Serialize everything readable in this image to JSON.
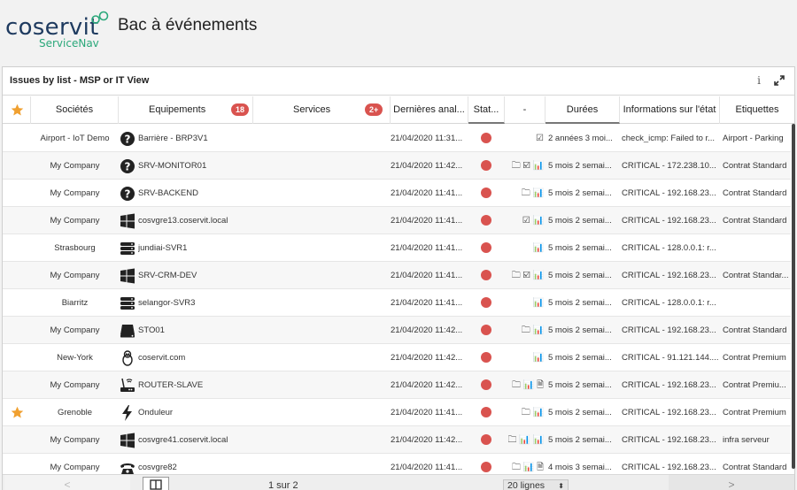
{
  "brand": {
    "name": "coservit",
    "sub": "ServiceNav",
    "accent": "#2aa87a",
    "primary": "#1e3a5f"
  },
  "page_title": "Bac à événements",
  "panel": {
    "title": "Issues by list - MSP or IT View",
    "info_icon": "info-icon",
    "expand_icon": "expand-icon"
  },
  "columns": {
    "companies": "Sociétés",
    "equipments": "Equipements",
    "equipments_badge": "18",
    "services": "Services",
    "services_badge": "2+",
    "last_analysis": "Dernières anal...",
    "status": "Stat...",
    "actions": "-",
    "durations": "Durées",
    "info": "Informations sur l'état",
    "tags": "Etiquettes"
  },
  "rows": [
    {
      "star": false,
      "company": "Airport - IoT Demo",
      "icon": "question",
      "equipment": "Barrière - BRP3V1",
      "date": "21/04/2020 11:31...",
      "actions": "☑",
      "duration": "2 années 3 moi...",
      "info": "check_icmp: Failed to r...",
      "tags": "Airport - Parking"
    },
    {
      "star": false,
      "company": "My Company",
      "icon": "question",
      "equipment": "SRV-MONITOR01",
      "date": "21/04/2020 11:42...",
      "actions": "🗀 ☑ 📊",
      "duration": "5 mois 2 semai...",
      "info": "CRITICAL - 172.238.10...",
      "tags": "Contrat Standard"
    },
    {
      "star": false,
      "company": "My Company",
      "icon": "question",
      "equipment": "SRV-BACKEND",
      "date": "21/04/2020 11:41...",
      "actions": "🗀 📊",
      "duration": "5 mois 2 semai...",
      "info": "CRITICAL - 192.168.23...",
      "tags": "Contrat Standard"
    },
    {
      "star": false,
      "company": "My Company",
      "icon": "windows",
      "equipment": "cosvgre13.coservit.local",
      "date": "21/04/2020 11:41...",
      "actions": "☑ 📊",
      "duration": "5 mois 2 semai...",
      "info": "CRITICAL - 192.168.23...",
      "tags": "Contrat Standard"
    },
    {
      "star": false,
      "company": "Strasbourg",
      "icon": "server",
      "equipment": "jundiai-SVR1",
      "date": "21/04/2020 11:41...",
      "actions": "📊",
      "duration": "5 mois 2 semai...",
      "info": "CRITICAL - 128.0.0.1: r...",
      "tags": ""
    },
    {
      "star": false,
      "company": "My Company",
      "icon": "windows",
      "equipment": "SRV-CRM-DEV",
      "date": "21/04/2020 11:41...",
      "actions": "🗀 ☑ 📊",
      "duration": "5 mois 2 semai...",
      "info": "CRITICAL - 192.168.23...",
      "tags": "Contrat Standar..."
    },
    {
      "star": false,
      "company": "Biarritz",
      "icon": "server",
      "equipment": "selangor-SVR3",
      "date": "21/04/2020 11:41...",
      "actions": "📊",
      "duration": "5 mois 2 semai...",
      "info": "CRITICAL - 128.0.0.1: r...",
      "tags": ""
    },
    {
      "star": false,
      "company": "My Company",
      "icon": "storage",
      "equipment": "STO01",
      "date": "21/04/2020 11:42...",
      "actions": "🗀 📊",
      "duration": "5 mois 2 semai...",
      "info": "CRITICAL - 192.168.23...",
      "tags": "Contrat Standard"
    },
    {
      "star": false,
      "company": "New-York",
      "icon": "linux",
      "equipment": "coservit.com",
      "date": "21/04/2020 11:42...",
      "actions": "📊",
      "duration": "5 mois 2 semai...",
      "info": "CRITICAL - 91.121.144....",
      "tags": "Contrat Premium"
    },
    {
      "star": false,
      "company": "My Company",
      "icon": "router",
      "equipment": "ROUTER-SLAVE",
      "date": "21/04/2020 11:42...",
      "actions": "🗀 📊 🗎",
      "duration": "5 mois 2 semai...",
      "info": "CRITICAL - 192.168.23...",
      "tags": "Contrat Premiu..."
    },
    {
      "star": true,
      "company": "Grenoble",
      "icon": "power",
      "equipment": "Onduleur",
      "date": "21/04/2020 11:41...",
      "actions": "🗀 📊",
      "duration": "5 mois 2 semai...",
      "info": "CRITICAL - 192.168.23...",
      "tags": "Contrat Premium"
    },
    {
      "star": false,
      "company": "My Company",
      "icon": "windows",
      "equipment": "cosvgre41.coservit.local",
      "date": "21/04/2020 11:42...",
      "actions": "🗀 📊 📊",
      "duration": "5 mois 2 semai...",
      "info": "CRITICAL - 192.168.23...",
      "tags": "infra serveur"
    },
    {
      "star": false,
      "company": "My Company",
      "icon": "phone",
      "equipment": "cosvgre82",
      "date": "21/04/2020 11:41...",
      "actions": "🗀 📊 🗎",
      "duration": "4 mois 3 semai...",
      "info": "CRITICAL - 192.168.23...",
      "tags": "Contrat Standard"
    }
  ],
  "pager": {
    "prev": "<",
    "next": ">",
    "page": "1 sur 2",
    "page_size": "20 lignes"
  },
  "colors": {
    "status_critical": "#d9534f",
    "star": "#f0a030",
    "badge": "#d9534f"
  }
}
